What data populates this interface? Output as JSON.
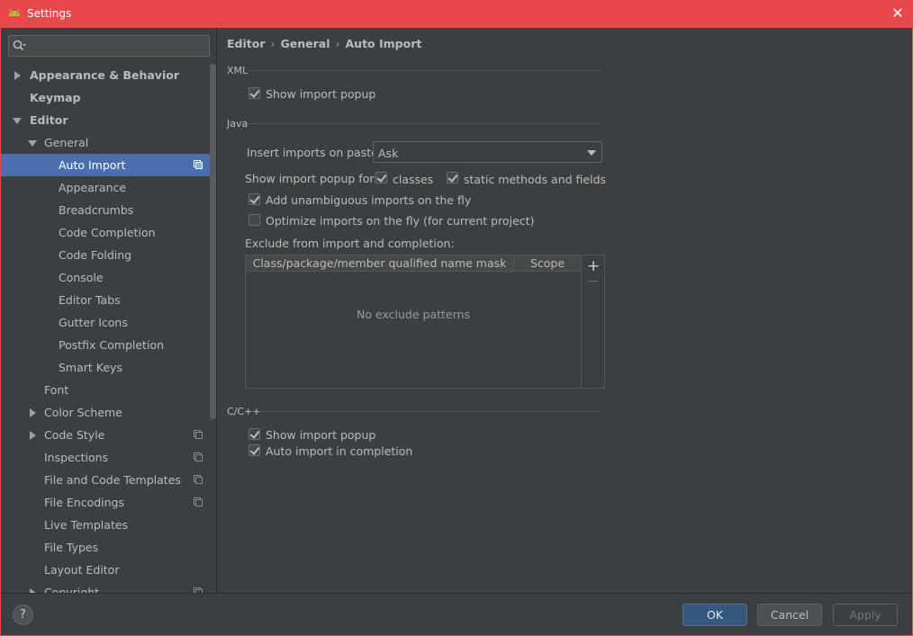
{
  "window": {
    "title": "Settings"
  },
  "sidebar": {
    "search": {
      "value": ""
    },
    "items": [
      {
        "label": "Appearance & Behavior"
      },
      {
        "label": "Keymap"
      },
      {
        "label": "Editor"
      },
      {
        "label": "General"
      },
      {
        "label": "Auto Import"
      },
      {
        "label": "Appearance"
      },
      {
        "label": "Breadcrumbs"
      },
      {
        "label": "Code Completion"
      },
      {
        "label": "Code Folding"
      },
      {
        "label": "Console"
      },
      {
        "label": "Editor Tabs"
      },
      {
        "label": "Gutter Icons"
      },
      {
        "label": "Postfix Completion"
      },
      {
        "label": "Smart Keys"
      },
      {
        "label": "Font"
      },
      {
        "label": "Color Scheme"
      },
      {
        "label": "Code Style"
      },
      {
        "label": "Inspections"
      },
      {
        "label": "File and Code Templates"
      },
      {
        "label": "File Encodings"
      },
      {
        "label": "Live Templates"
      },
      {
        "label": "File Types"
      },
      {
        "label": "Layout Editor"
      },
      {
        "label": "Copyright"
      }
    ]
  },
  "breadcrumb": {
    "part1": "Editor",
    "part2": "General",
    "part3": "Auto Import"
  },
  "xml": {
    "header": "XML",
    "show_import_popup": {
      "label": "Show import popup",
      "checked": true
    }
  },
  "java": {
    "header": "Java",
    "insert_on_paste": {
      "label": "Insert imports on paste:",
      "value": "Ask"
    },
    "show_popup_for_label": "Show import popup for:",
    "classes": {
      "label": "classes",
      "checked": true
    },
    "static_methods": {
      "label": "static methods and fields",
      "checked": true
    },
    "add_unambiguous": {
      "label": "Add unambiguous imports on the fly",
      "checked": true
    },
    "optimize": {
      "label": "Optimize imports on the fly (for current project)",
      "checked": false
    },
    "exclude_label": "Exclude from import and completion:",
    "table": {
      "col1": "Class/package/member qualified name mask",
      "col2": "Scope",
      "empty": "No exclude patterns"
    }
  },
  "cpp": {
    "header": "C/C++",
    "show_import_popup": {
      "label": "Show import popup",
      "checked": true
    },
    "auto_import": {
      "label": "Auto import in completion",
      "checked": true
    }
  },
  "footer": {
    "help": "?",
    "ok": "OK",
    "cancel": "Cancel",
    "apply": "Apply"
  }
}
